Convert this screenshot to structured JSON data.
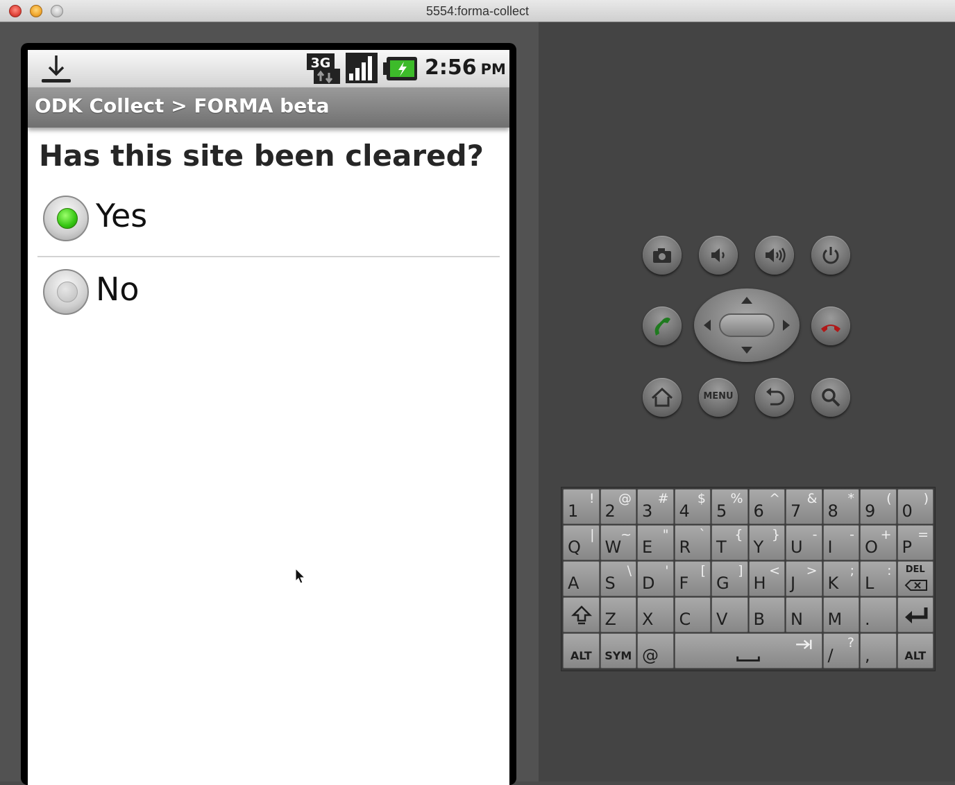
{
  "window": {
    "title": "5554:forma-collect"
  },
  "statusbar": {
    "network": "3G",
    "time": "2:56",
    "ampm": "PM"
  },
  "app": {
    "breadcrumb": "ODK Collect > FORMA beta",
    "question": "Has this site been cleared?",
    "options": [
      {
        "label": "Yes",
        "selected": true
      },
      {
        "label": "No",
        "selected": false
      }
    ]
  },
  "hardware": {
    "buttons": [
      "camera-icon",
      "volume-down-icon",
      "volume-up-icon",
      "power-icon",
      "call-icon",
      "dpad",
      "end-call-icon",
      "home-icon",
      "menu",
      "back-icon",
      "search-icon"
    ],
    "menu_label": "MENU"
  },
  "keyboard": {
    "row1": [
      {
        "main": "1",
        "sub": "!"
      },
      {
        "main": "2",
        "sub": "@"
      },
      {
        "main": "3",
        "sub": "#"
      },
      {
        "main": "4",
        "sub": "$"
      },
      {
        "main": "5",
        "sub": "%"
      },
      {
        "main": "6",
        "sub": "^"
      },
      {
        "main": "7",
        "sub": "&"
      },
      {
        "main": "8",
        "sub": "*"
      },
      {
        "main": "9",
        "sub": "("
      },
      {
        "main": "0",
        "sub": ")"
      }
    ],
    "row2": [
      {
        "main": "Q",
        "sub": "|"
      },
      {
        "main": "W",
        "sub": "~"
      },
      {
        "main": "E",
        "sub": "\""
      },
      {
        "main": "R",
        "sub": "`"
      },
      {
        "main": "T",
        "sub": "{"
      },
      {
        "main": "Y",
        "sub": "}"
      },
      {
        "main": "U",
        "sub": "-"
      },
      {
        "main": "I",
        "sub": "-"
      },
      {
        "main": "O",
        "sub": "+"
      },
      {
        "main": "P",
        "sub": "="
      }
    ],
    "row3": [
      {
        "main": "A",
        "sub": ""
      },
      {
        "main": "S",
        "sub": "\\"
      },
      {
        "main": "D",
        "sub": "'"
      },
      {
        "main": "F",
        "sub": "["
      },
      {
        "main": "G",
        "sub": "]"
      },
      {
        "main": "H",
        "sub": "<"
      },
      {
        "main": "J",
        "sub": ">"
      },
      {
        "main": "K",
        "sub": ";"
      },
      {
        "main": "L",
        "sub": ":"
      }
    ],
    "del_label": "DEL",
    "row4": [
      {
        "main": "Z",
        "sub": ""
      },
      {
        "main": "X",
        "sub": ""
      },
      {
        "main": "C",
        "sub": ""
      },
      {
        "main": "V",
        "sub": ""
      },
      {
        "main": "B",
        "sub": ""
      },
      {
        "main": "N",
        "sub": ""
      },
      {
        "main": "M",
        "sub": ""
      },
      {
        "main": ".",
        "sub": ""
      }
    ],
    "alt_label": "ALT",
    "sym_label": "SYM",
    "at_label": "@",
    "slash_key": {
      "main": "/",
      "sub": "?"
    },
    "comma_key": {
      "main": ",",
      "sub": ""
    }
  }
}
